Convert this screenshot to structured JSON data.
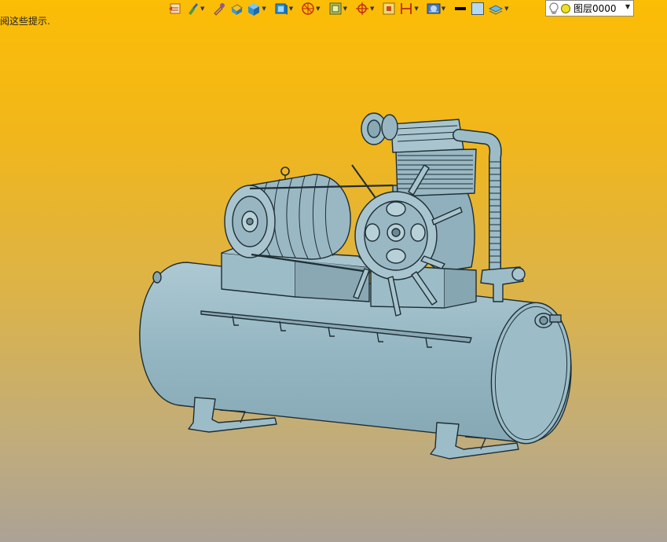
{
  "hint_text": "阅这些提示.",
  "toolbar": {
    "items": [
      {
        "icon": "open-file-icon",
        "has_dropdown": false
      },
      {
        "icon": "brush-icon",
        "has_dropdown": true
      },
      {
        "icon": "eyedropper-icon",
        "has_dropdown": false
      },
      {
        "icon": "paint-bucket-icon",
        "has_dropdown": false
      },
      {
        "icon": "box-3d-icon",
        "has_dropdown": true
      },
      {
        "icon": "view-cube-icon",
        "has_dropdown": true
      },
      {
        "icon": "sphere-view-icon",
        "has_dropdown": true
      },
      {
        "icon": "display-style-icon",
        "has_dropdown": true
      },
      {
        "icon": "target-icon",
        "has_dropdown": true
      },
      {
        "icon": "section-icon",
        "has_dropdown": false
      },
      {
        "icon": "dimension-icon",
        "has_dropdown": true
      },
      {
        "icon": "graphics-settings-icon",
        "has_dropdown": true
      },
      {
        "icon": "line-color-icon",
        "has_dropdown": false
      },
      {
        "icon": "fill-color-icon",
        "has_dropdown": false
      },
      {
        "icon": "layer-manager-icon",
        "has_dropdown": true
      }
    ]
  },
  "layer": {
    "value": "图层0000",
    "bulb_icon": "light-bulb-icon",
    "state_icon": "layer-on-icon"
  },
  "colors": {
    "background_top": "#fcbd05",
    "background_bottom": "#aca296",
    "model_fill": "#9fbfcb",
    "model_edge": "#1e2e34"
  }
}
